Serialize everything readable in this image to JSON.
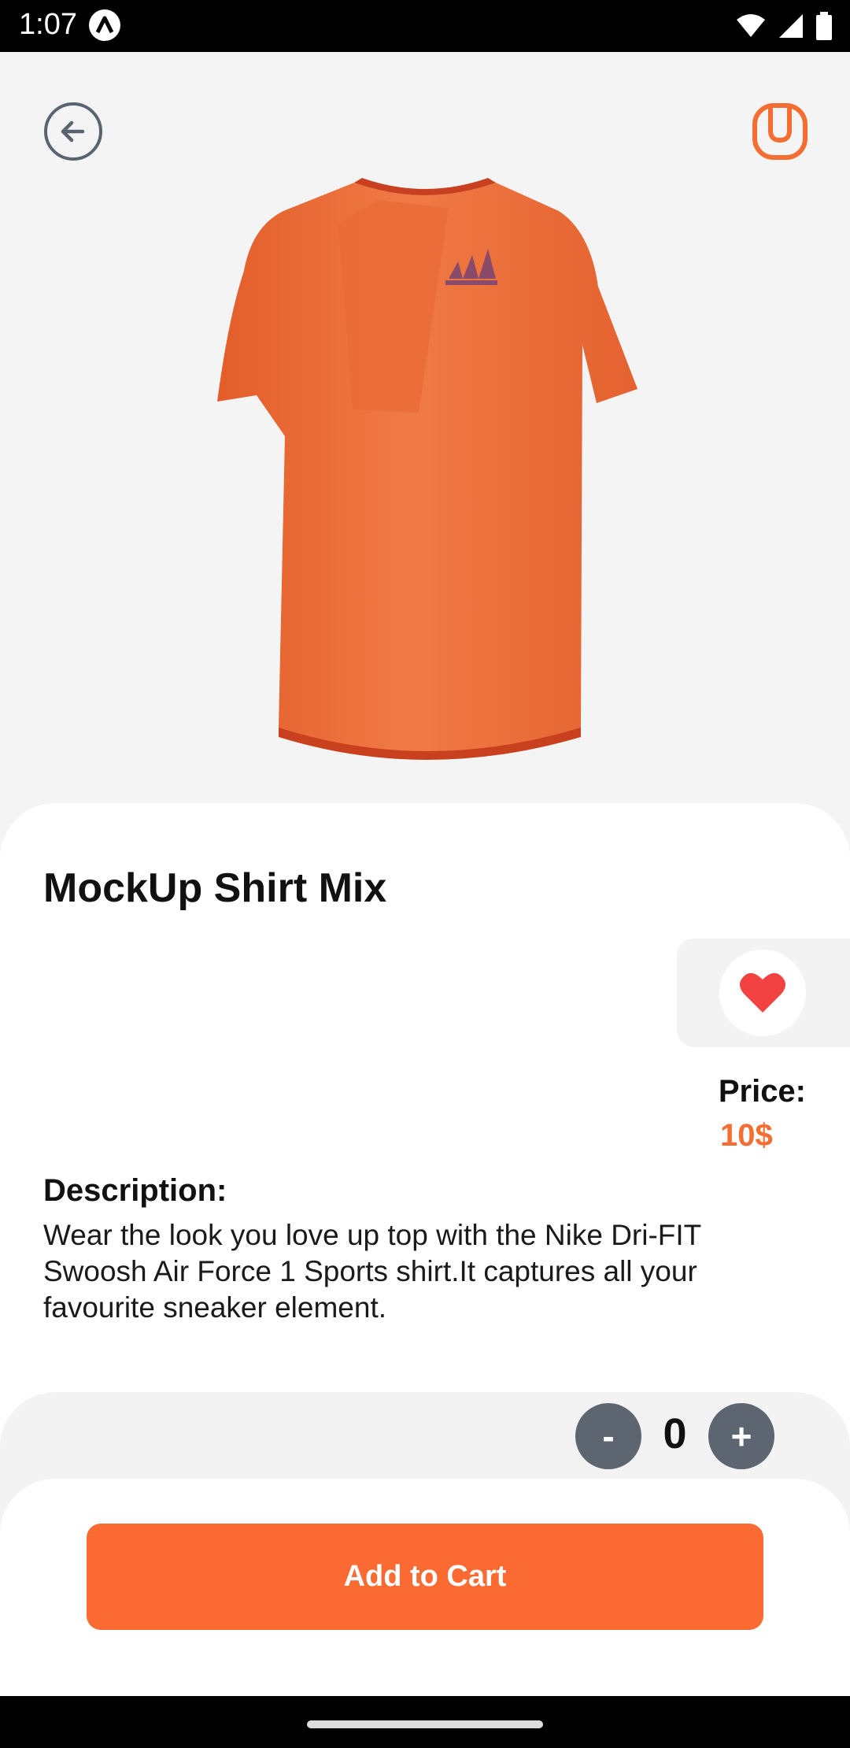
{
  "status_bar": {
    "time": "1:07",
    "icons": [
      "app-badge-icon",
      "wifi-icon",
      "signal-icon",
      "battery-icon"
    ]
  },
  "header": {
    "back_icon": "arrow-left-icon",
    "brand_icon": "brand-logo-icon"
  },
  "product": {
    "title": "MockUp Shirt Mix",
    "favorite_icon": "heart-icon",
    "price_label": "Price:",
    "price_value": "10$",
    "description_label": "Description:",
    "description": "Wear the look you love up top with the Nike Dri-FIT Swoosh Air Force 1 Sports shirt.It captures all your favourite sneaker element."
  },
  "quantity": {
    "minus_label": "-",
    "value": "0",
    "plus_label": "+"
  },
  "cart": {
    "button_label": "Add to Cart"
  },
  "colors": {
    "accent": "#fb6a33",
    "price": "#f46d32",
    "favorite": "#f24141",
    "qty_button": "#5d6670"
  }
}
